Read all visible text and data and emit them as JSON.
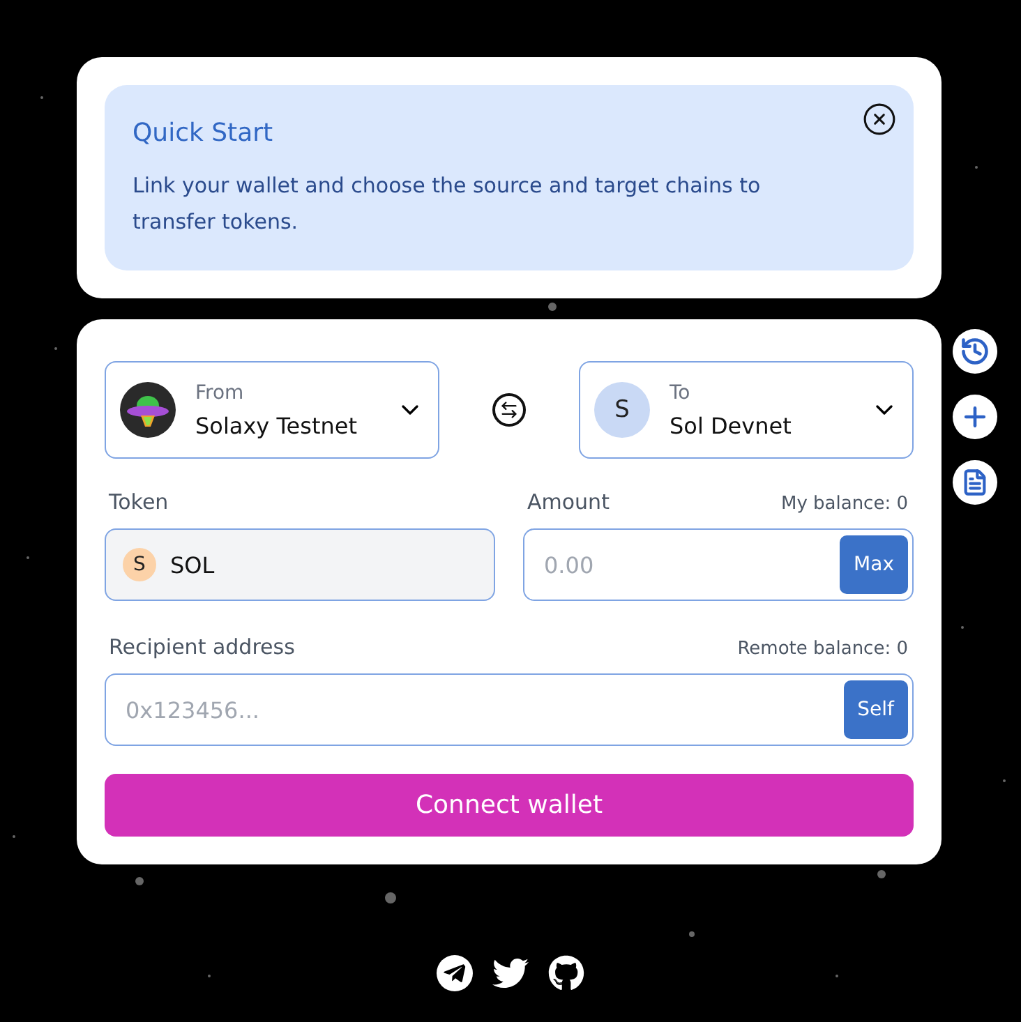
{
  "quick_start": {
    "title": "Quick Start",
    "text": "Link your wallet and choose the source and target chains to transfer tokens."
  },
  "from": {
    "label": "From",
    "chain": "Solaxy Testnet"
  },
  "to": {
    "label": "To",
    "chain": "Sol Devnet",
    "avatar": "S"
  },
  "token": {
    "label": "Token",
    "avatar": "S",
    "value": "SOL"
  },
  "amount": {
    "label": "Amount",
    "balance": "My balance: 0",
    "placeholder": "0.00",
    "button": "Max"
  },
  "recipient": {
    "label": "Recipient address",
    "balance": "Remote balance: 0",
    "placeholder": "0x123456...",
    "button": "Self"
  },
  "connect_button": "Connect wallet"
}
